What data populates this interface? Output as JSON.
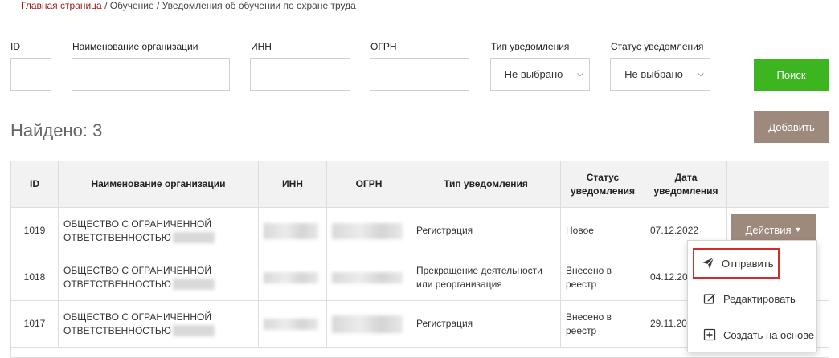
{
  "breadcrumb": {
    "home": "Главная страница",
    "separator": " / ",
    "section": "Обучение",
    "page": "Уведомления об обучении по охране труда"
  },
  "filters": {
    "id_label": "ID",
    "org_label": "Наименование организации",
    "inn_label": "ИНН",
    "ogrn_label": "ОГРН",
    "type_label": "Тип уведомления",
    "type_value": "Не выбрано",
    "status_label": "Статус уведомления",
    "status_value": "Не выбрано",
    "search_button": "Поиск"
  },
  "found_text": "Найдено: 3",
  "add_button": "Добавить",
  "table": {
    "headers": {
      "id": "ID",
      "org": "Наименование организации",
      "inn": "ИНН",
      "ogrn": "ОГРН",
      "type": "Тип уведомления",
      "status": "Статус уведомления",
      "date": "Дата уведомления"
    },
    "rows": [
      {
        "id": "1019",
        "org_line1": "ОБЩЕСТВО С ОГРАНИЧЕННОЙ",
        "org_line2": "ОТВЕТСТВЕННОСТЬЮ",
        "type": "Регистрация",
        "status": "Новое",
        "date": "07.12.2022"
      },
      {
        "id": "1018",
        "org_line1": "ОБЩЕСТВО С ОГРАНИЧЕННОЙ",
        "org_line2": "ОТВЕТСТВЕННОСТЬЮ",
        "type": "Прекращение деятельности или реорганизация",
        "status": "Внесено в реестр",
        "date": "04.12.20"
      },
      {
        "id": "1017",
        "org_line1": "ОБЩЕСТВО С ОГРАНИЧЕННОЙ",
        "org_line2": "ОТВЕТСТВЕННОСТЬЮ",
        "type": "Регистрация",
        "status": "Внесено в реестр",
        "date": "29.11.20"
      }
    ]
  },
  "actions_button": "Действия",
  "dropdown": {
    "send": "Отправить",
    "edit": "Редактировать",
    "create_based": "Создать на основе"
  },
  "colors": {
    "search_button": "#3cb521",
    "brown_button": "#9e8a7d",
    "highlight_border": "#d62b2b",
    "breadcrumb_link": "#9b1b1b"
  }
}
